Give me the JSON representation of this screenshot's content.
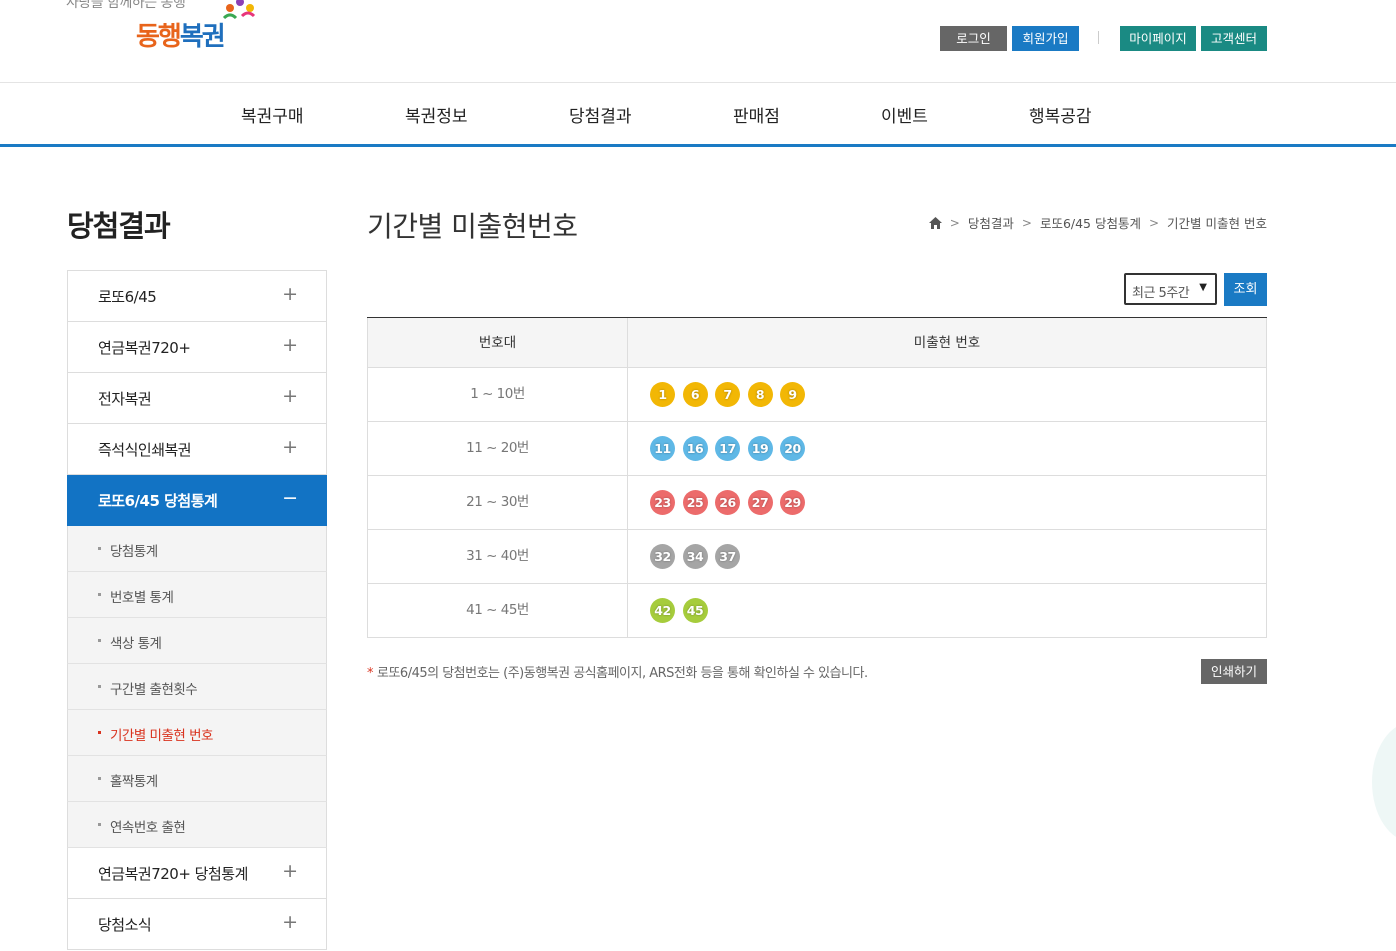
{
  "header": {
    "logo": {
      "slogan": "사랑을 함께하는 동행",
      "name_part1": "동행",
      "name_part2": "복권"
    },
    "utility": {
      "login": "로그인",
      "join": "회원가입",
      "mypage": "마이페이지",
      "customer_center": "고객센터"
    }
  },
  "gnb": {
    "items": [
      "복권구매",
      "복권정보",
      "당첨결과",
      "판매점",
      "이벤트",
      "행복공감"
    ]
  },
  "sidebar": {
    "title": "당첨결과",
    "items": [
      {
        "label": "로또6/45",
        "toggle": "+"
      },
      {
        "label": "연금복권720+",
        "toggle": "+"
      },
      {
        "label": "전자복권",
        "toggle": "+"
      },
      {
        "label": "즉석식인쇄복권",
        "toggle": "+"
      },
      {
        "label": "로또6/45 당첨통계",
        "toggle": "−"
      },
      {
        "label": "연금복권720+ 당첨통계",
        "toggle": "+"
      },
      {
        "label": "당첨소식",
        "toggle": "+"
      }
    ],
    "subitems": [
      "당첨통계",
      "번호별 통계",
      "색상 통계",
      "구간별 출현횟수",
      "기간별 미출현 번호",
      "홀짝통계",
      "연속번호 출현"
    ],
    "active_subitem": "기간별 미출현 번호"
  },
  "main": {
    "title": "기간별 미출현번호",
    "breadcrumb": {
      "home_icon": "home-icon",
      "items": [
        "당첨결과",
        "로또6/45 당첨통계",
        "기간별 미출현 번호"
      ]
    },
    "period_select": {
      "value": "최근 5주간"
    },
    "search_button": "조회",
    "table": {
      "headers": [
        "번호대",
        "미출현 번호"
      ],
      "rows": [
        {
          "range": "1 ~ 10번",
          "color": "#f2b705",
          "numbers": [
            "1",
            "6",
            "7",
            "8",
            "9"
          ]
        },
        {
          "range": "11 ~ 20번",
          "color": "#5fb8e6",
          "numbers": [
            "11",
            "16",
            "17",
            "19",
            "20"
          ]
        },
        {
          "range": "21 ~ 30번",
          "color": "#ec6b6b",
          "numbers": [
            "23",
            "25",
            "26",
            "27",
            "29"
          ]
        },
        {
          "range": "31 ~ 40번",
          "color": "#a5a5a5",
          "numbers": [
            "32",
            "34",
            "37"
          ]
        },
        {
          "range": "41 ~ 45번",
          "color": "#a6cc3c",
          "numbers": [
            "42",
            "45"
          ]
        }
      ]
    },
    "notice": {
      "mark": "*",
      "text": "로또6/45의 당첨번호는 (주)동행복권 공식홈페이지, ARS전화 등을 통해 확인하실 수 있습니다."
    },
    "print_button": "인쇄하기"
  },
  "colors": {
    "primary": "#1a7ac4",
    "teal": "#1a8a83",
    "active_sub": "#d9331f",
    "dark_button": "#666666"
  }
}
